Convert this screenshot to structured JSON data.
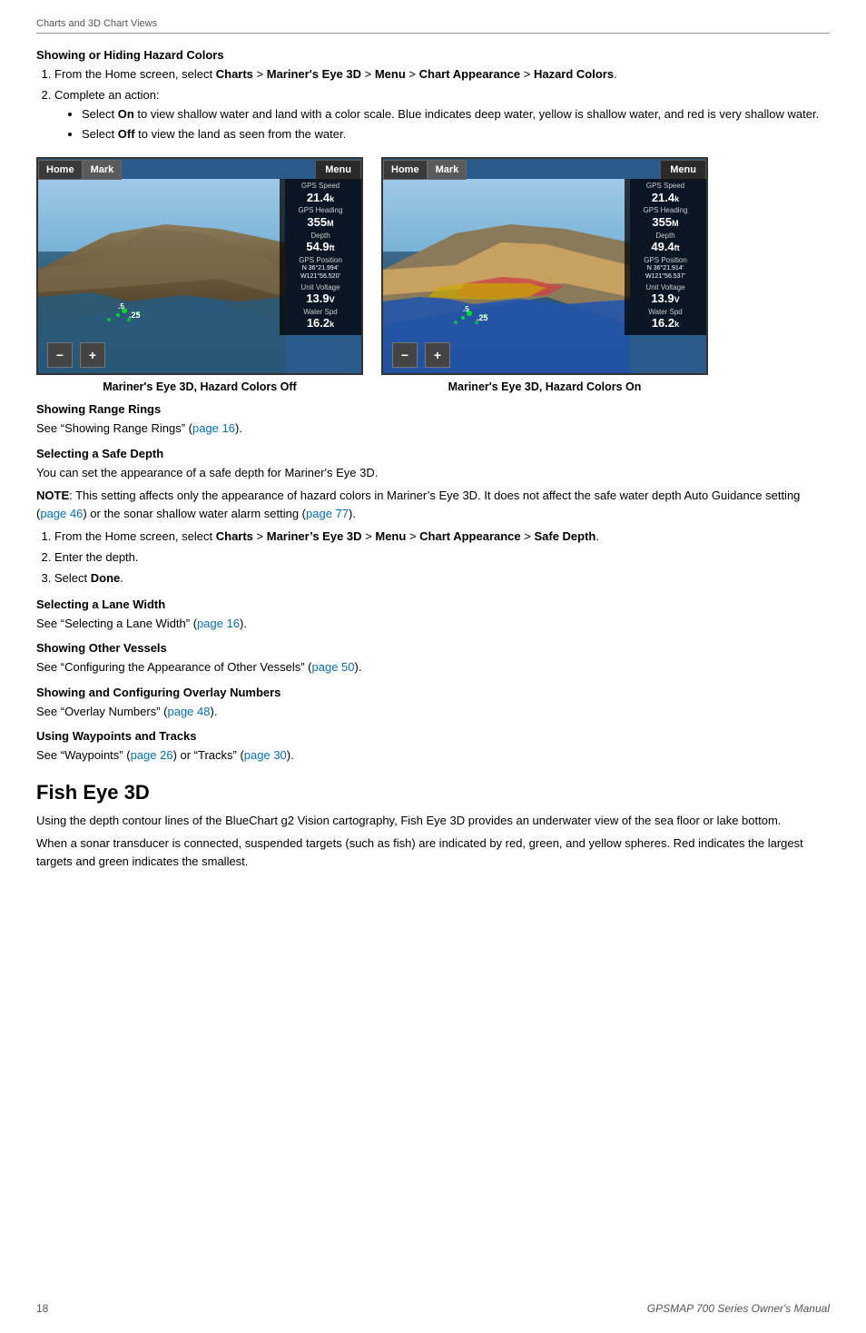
{
  "page": {
    "header": "Charts and 3D Chart Views",
    "footer_left": "18",
    "footer_right": "GPSMAP 700 Series Owner's Manual"
  },
  "sections": {
    "hazard_colors": {
      "title": "Showing or Hiding Hazard Colors",
      "step1": "From the Home screen, select ",
      "step1_bold1": "Charts",
      "step1_sep1": " > ",
      "step1_bold2": "Mariner's Eye 3D",
      "step1_sep2": " > ",
      "step1_bold3": "Menu",
      "step1_sep3": " > ",
      "step1_bold4": "Chart Appearance",
      "step1_sep4": " > ",
      "step1_bold5": "Hazard Colors",
      "step1_end": ".",
      "step2": "Complete an action:",
      "bullet1_prefix": "Select ",
      "bullet1_bold": "On",
      "bullet1_text": " to view shallow water and land with a color scale. Blue indicates deep water, yellow is shallow water, and red is very shallow water.",
      "bullet2_prefix": "Select ",
      "bullet2_bold": "Off",
      "bullet2_text": " to view the land as seen from the water.",
      "caption_left": "Mariner's Eye 3D, Hazard Colors Off",
      "caption_right": "Mariner's Eye 3D, Hazard Colors On"
    },
    "range_rings": {
      "title": "Showing Range Rings",
      "text_prefix": "See “Showing Range Rings” (",
      "link_text": "page 16",
      "link_href": "#page16",
      "text_suffix": ")."
    },
    "safe_depth": {
      "title": "Selecting a Safe Depth",
      "body1": "You can set the appearance of a safe depth for Mariner's Eye 3D.",
      "note_bold": "NOTE",
      "note_text": ": This setting affects only the appearance of hazard colors in Mariner’s Eye 3D. It does not affect the safe water depth Auto Guidance setting (",
      "note_link1": "page 46",
      "note_link1_href": "#page46",
      "note_mid": ") or the sonar shallow water alarm setting (",
      "note_link2": "page 77",
      "note_link2_href": "#page77",
      "note_end": ").",
      "step1": "From the Home screen, select ",
      "step1_bold1": "Charts",
      "step1_sep1": " > ",
      "step1_bold2": "Mariner’s Eye 3D",
      "step1_sep2": " > ",
      "step1_bold3": "Menu",
      "step1_sep3": " > ",
      "step1_bold4": "Chart Appearance",
      "step1_sep4": " > ",
      "step1_bold5": "Safe Depth",
      "step1_end": ".",
      "step2": "Enter the depth.",
      "step3_prefix": "Select ",
      "step3_bold": "Done",
      "step3_end": "."
    },
    "lane_width": {
      "title": "Selecting a Lane Width",
      "text_prefix": "See “Selecting a Lane Width” (",
      "link_text": "page 16",
      "link_href": "#page16",
      "text_suffix": ")."
    },
    "other_vessels": {
      "title": "Showing Other Vessels",
      "text_prefix": "See “Configuring the Appearance of Other Vessels” (",
      "link_text": "page 50",
      "link_href": "#page50",
      "text_suffix": ")."
    },
    "overlay_numbers": {
      "title": "Showing and Configuring Overlay Numbers",
      "text_prefix": "See “Overlay Numbers” (",
      "link_text": "page 48",
      "link_href": "#page48",
      "text_suffix": ")."
    },
    "waypoints_tracks": {
      "title": "Using Waypoints and Tracks",
      "text_prefix": "See “Waypoints” (",
      "link1_text": "page 26",
      "link1_href": "#page26",
      "text_mid": ") or “Tracks” (",
      "link2_text": "page 30",
      "link2_href": "#page30",
      "text_suffix": ")."
    },
    "fish_eye_3d": {
      "title": "Fish Eye 3D",
      "body1": "Using the depth contour lines of the BlueChart g2 Vision cartography, Fish Eye 3D provides an underwater view of the sea floor or lake bottom.",
      "body2": "When a sonar transducer is connected, suspended targets (such as fish) are indicated by red, green, and yellow spheres. Red indicates the largest targets and green indicates the smallest."
    }
  },
  "chart_left": {
    "btn_home": "Home",
    "btn_mark": "Mark",
    "btn_menu": "Menu",
    "gps_speed_label": "GPS Speed",
    "gps_speed_value": "21.4",
    "gps_speed_unit": "k",
    "gps_heading_label": "GPS Heading",
    "gps_heading_value": "355",
    "gps_heading_unit": "M",
    "depth_label": "Depth",
    "depth_value": "54.9",
    "depth_unit": "ft",
    "gps_pos_label": "GPS Position",
    "gps_pos_line1": "N 36°21.994’",
    "gps_pos_line2": "W121°56.520’",
    "unit_voltage_label": "Unit Voltage",
    "unit_voltage_value": "13.9",
    "unit_voltage_unit": "V",
    "water_spd_label": "Water Spd",
    "water_spd_value": "16.2",
    "water_spd_unit": "k"
  },
  "chart_right": {
    "btn_home": "Home",
    "btn_mark": "Mark",
    "btn_menu": "Menu",
    "gps_speed_label": "GPS Speed",
    "gps_speed_value": "21.4",
    "gps_speed_unit": "k",
    "gps_heading_label": "GPS Heading",
    "gps_heading_value": "355",
    "gps_heading_unit": "M",
    "depth_label": "Depth",
    "depth_value": "49.4",
    "depth_unit": "ft",
    "gps_pos_label": "GPS Position",
    "gps_pos_line1": "N 36°21.914’",
    "gps_pos_line2": "W121°56.537’",
    "unit_voltage_label": "Unit Voltage",
    "unit_voltage_value": "13.9",
    "unit_voltage_unit": "V",
    "water_spd_label": "Water Spd",
    "water_spd_value": "16.2",
    "water_spd_unit": "k"
  }
}
